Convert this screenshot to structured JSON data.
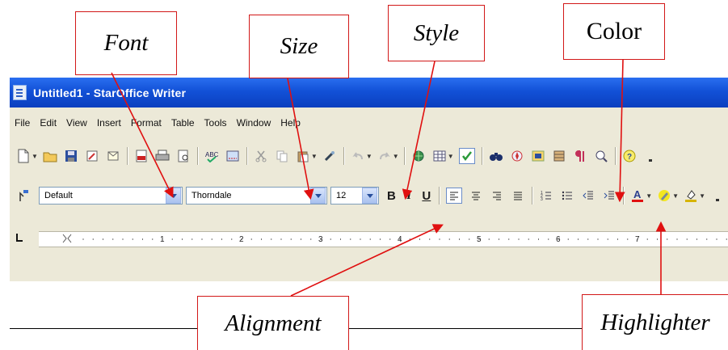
{
  "callouts": {
    "font": "Font",
    "size": "Size",
    "style": "Style",
    "color": "Color",
    "alignment": "Alignment",
    "highlighter": "Highlighter"
  },
  "window": {
    "title": "Untitled1 - StarOffice Writer"
  },
  "menu": [
    "File",
    "Edit",
    "View",
    "Insert",
    "Format",
    "Table",
    "Tools",
    "Window",
    "Help"
  ],
  "format_toolbar": {
    "paragraph_style": "Default",
    "font_name": "Thorndale",
    "font_size": "12",
    "bold": "B",
    "italic": "I",
    "underline": "U"
  },
  "ruler": {
    "numbers": [
      "1",
      "2",
      "3",
      "4",
      "5",
      "6",
      "7"
    ]
  },
  "colors": {
    "callout_border": "#d21818",
    "arrow": "#e01010",
    "titlebar": "#1251d7",
    "chrome": "#ece9d8",
    "font_color_bar": "#e01010",
    "highlight_bar": "#f5e600"
  }
}
